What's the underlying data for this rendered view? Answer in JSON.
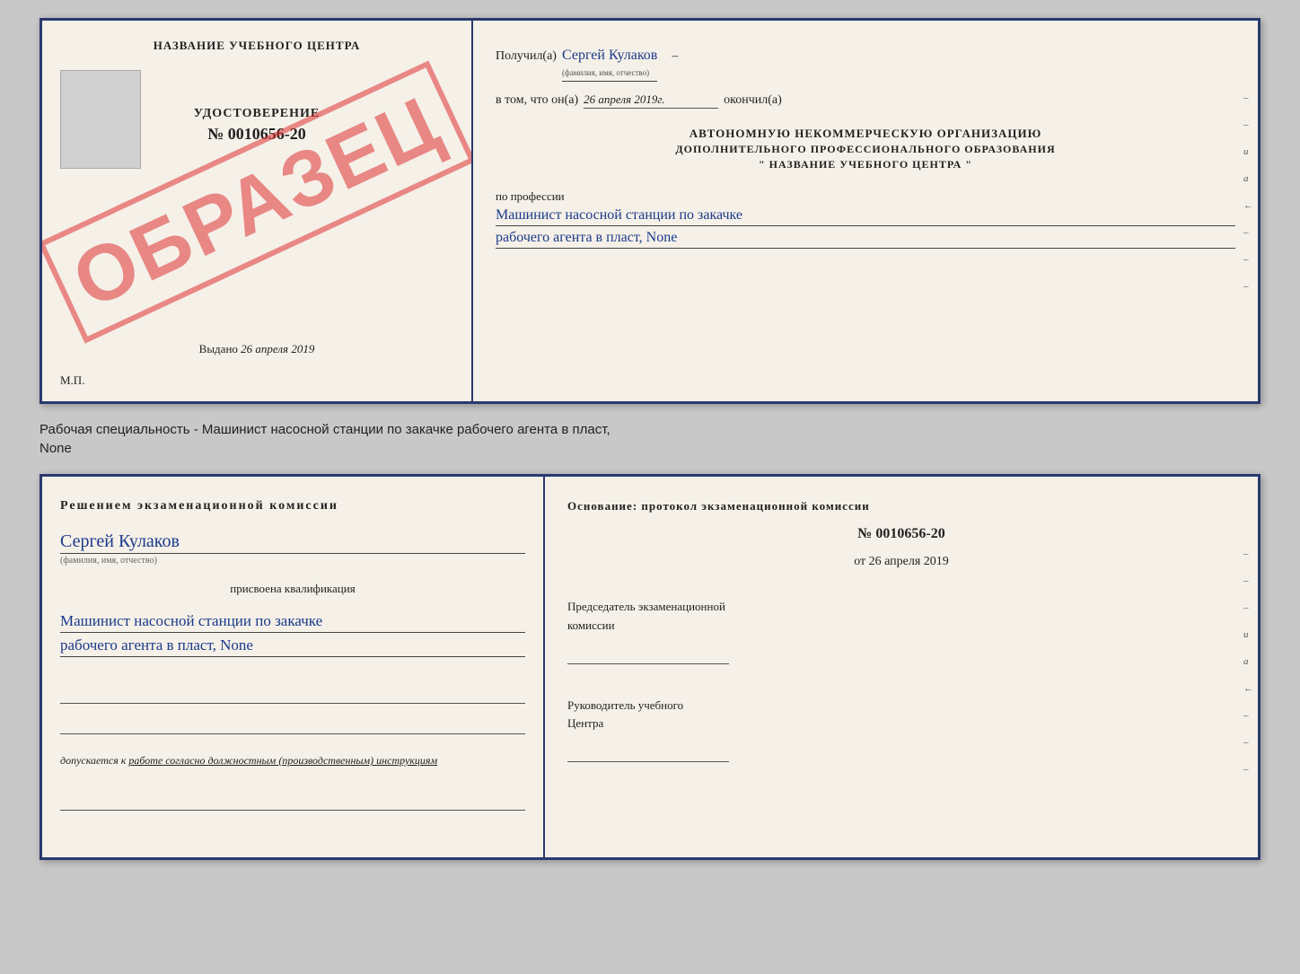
{
  "top_doc": {
    "left": {
      "center_title": "НАЗВАНИЕ УЧЕБНОГО ЦЕНТРА",
      "stamp_text": "ОБРАЗЕЦ",
      "udostoverenie_label": "УДОСТОВЕРЕНИЕ",
      "udostoverenie_num": "№ 0010656-20",
      "vydano_label": "Выдано",
      "vydano_date": "26 апреля 2019",
      "mp_label": "М.П."
    },
    "right": {
      "poluchil_label": "Получил(а)",
      "recipient_name": "Сергей Кулаков",
      "recipient_hint": "(фамилия, имя, отчество)",
      "vtom_label": "в том, что он(а)",
      "date_value": "26 апреля 2019г.",
      "okonchil_label": "окончил(а)",
      "org_title1": "АВТОНОМНУЮ НЕКОММЕРЧЕСКУЮ ОРГАНИЗАЦИЮ",
      "org_title2": "ДОПОЛНИТЕЛЬНОГО ПРОФЕССИОНАЛЬНОГО ОБРАЗОВАНИЯ",
      "org_name": "\" НАЗВАНИЕ УЧЕБНОГО ЦЕНТРА \"",
      "po_professii_label": "по профессии",
      "profession_line1": "Машинист насосной станции по закачке",
      "profession_line2": "рабочего агента в пласт, None"
    }
  },
  "caption": {
    "text1": "Рабочая специальность - Машинист насосной станции по закачке рабочего агента в пласт,",
    "text2": "None"
  },
  "bottom_doc": {
    "left": {
      "komissia_title": "Решением экзаменационной комиссии",
      "person_name": "Сергей Кулаков",
      "person_hint": "(фамилия, имя, отчество)",
      "prisvoena_label": "присвоена квалификация",
      "qualification_line1": "Машинист насосной станции по закачке",
      "qualification_line2": "рабочего агента в пласт, None",
      "dopuskaetsya_label": "допускается к",
      "dopuskaetsya_value": "работе согласно должностным (производственным) инструкциям"
    },
    "right": {
      "osnovaniye_label": "Основание: протокол экзаменационной комиссии",
      "protocol_num": "№ 0010656-20",
      "ot_label": "от",
      "ot_date": "26 апреля 2019",
      "chairman_label1": "Председатель экзаменационной",
      "chairman_label2": "комиссии",
      "rukovoditel_label1": "Руководитель учебного",
      "rukovoditel_label2": "Центра"
    }
  }
}
